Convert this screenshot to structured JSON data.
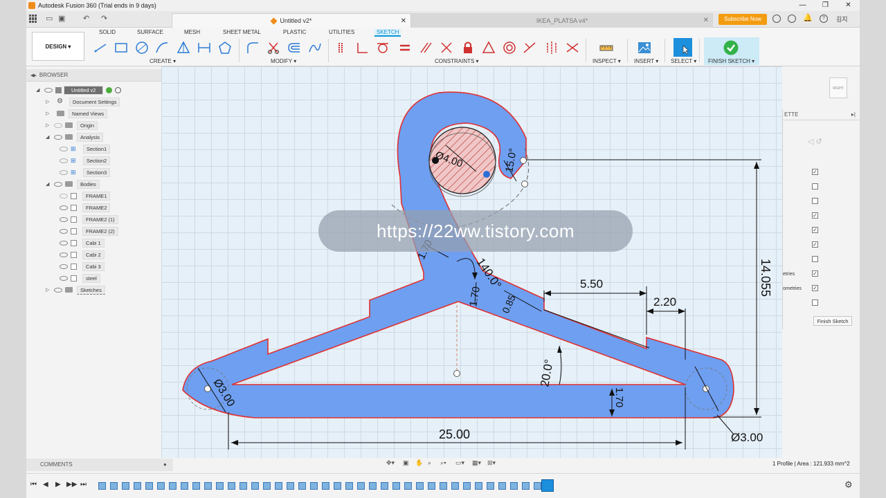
{
  "title_bar": {
    "title": "Autodesk Fusion 360 (Trial ends in 9 days)"
  },
  "tabs": [
    {
      "label": "Untitled v2*"
    },
    {
      "label": "IKEA_PLATSA v4*"
    }
  ],
  "header": {
    "subscribe_label": "Subscribe Now",
    "user_initials": "김지"
  },
  "ribbon": {
    "workspace_label": "DESIGN ▾",
    "tabs": [
      "SOLID",
      "SURFACE",
      "MESH",
      "SHEET METAL",
      "PLASTIC",
      "UTILITIES",
      "SKETCH"
    ],
    "groups": [
      "CREATE ▾",
      "MODIFY ▾",
      "CONSTRAINTS ▾",
      "INSPECT ▾",
      "INSERT ▾",
      "SELECT ▾",
      "FINISH SKETCH ▾"
    ]
  },
  "browser": {
    "title": "BROWSER",
    "items": [
      {
        "label": "Untitled v2"
      },
      {
        "label": "Document Settings"
      },
      {
        "label": "Named Views"
      },
      {
        "label": "Origin"
      },
      {
        "label": "Analysis"
      },
      {
        "label": "Section1"
      },
      {
        "label": "Section2"
      },
      {
        "label": "Section3"
      },
      {
        "label": "Bodies"
      },
      {
        "label": "FRAME1"
      },
      {
        "label": "FRAME2"
      },
      {
        "label": "FRAME2 (1)"
      },
      {
        "label": "FRAME2 (2)"
      },
      {
        "label": "Cabi 1"
      },
      {
        "label": "Cabi 2"
      },
      {
        "label": "Cabi 3"
      },
      {
        "label": "steel"
      },
      {
        "label": "Sketches"
      }
    ]
  },
  "dimensions": {
    "d_hole": "Ø4.00",
    "angle_top": "15.0°",
    "w1": "1.70",
    "angle_140": "140.0°",
    "w2": "1.70",
    "w3": "0.85",
    "d550": "5.50",
    "d220": "2.20",
    "angle_20": "20.0°",
    "d_left": "Ø3.00",
    "w4": "1.70",
    "d2500": "25.00",
    "d_right": "Ø3.00",
    "h14055": "14.055"
  },
  "view_cube": {
    "label": "RIGHT"
  },
  "palette": {
    "title": "ETTE",
    "rows": [
      "",
      "",
      "",
      "",
      "",
      "",
      "",
      "etries",
      "ometries",
      ""
    ],
    "finish_label": "Finish Sketch"
  },
  "comments": {
    "label": "COMMENTS"
  },
  "status": {
    "text": "1 Profile | Area : 121.933 mm^2"
  },
  "watermark": {
    "text": "https://22ww.tistory.com"
  },
  "colors": {
    "accent": "#0696d7",
    "profile_fill": "#6f9ff0",
    "profile_edge": "#e03030",
    "dim": "#111111",
    "subscribe": "#f39c12"
  }
}
